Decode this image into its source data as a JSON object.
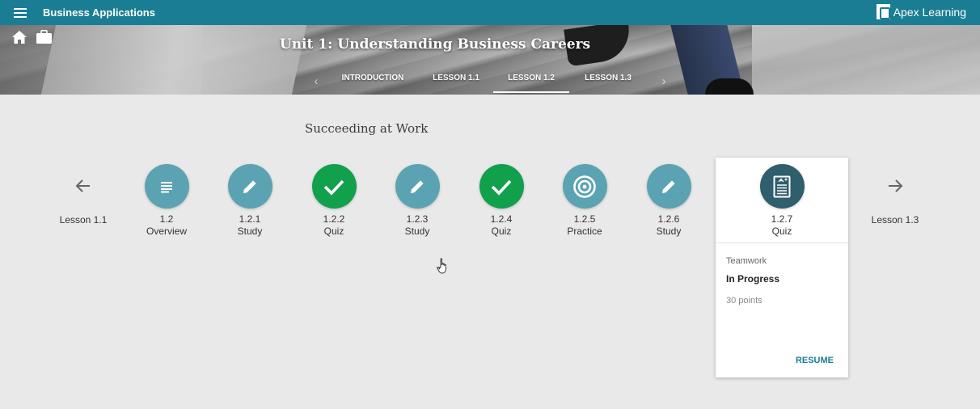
{
  "app": {
    "menu_icon": "hamburger-menu-icon",
    "title": "Business Applications",
    "brand": "Apex Learning"
  },
  "banner": {
    "unit_title": "Unit 1: Understanding Business Careers",
    "tabs": [
      {
        "label": "INTRODUCTION",
        "active": false
      },
      {
        "label": "LESSON 1.1",
        "active": false
      },
      {
        "label": "LESSON 1.2",
        "active": true
      },
      {
        "label": "LESSON 1.3",
        "active": false
      }
    ],
    "prev_icon": "chevron-left-icon",
    "next_icon": "chevron-right-icon",
    "home_icon": "home-icon",
    "briefcase_icon": "briefcase-icon"
  },
  "lesson": {
    "title": "Succeeding at Work",
    "prev_label": "Lesson 1.1",
    "next_label": "Lesson 1.3",
    "steps": [
      {
        "num": "1.2",
        "kind": "Overview",
        "icon": "overview-list-icon",
        "color": "#5ba3b3"
      },
      {
        "num": "1.2.1",
        "kind": "Study",
        "icon": "pencil-icon",
        "color": "#5ba3b3"
      },
      {
        "num": "1.2.2",
        "kind": "Quiz",
        "icon": "checkmark-icon",
        "color": "#11a04c"
      },
      {
        "num": "1.2.3",
        "kind": "Study",
        "icon": "pencil-icon",
        "color": "#5ba3b3"
      },
      {
        "num": "1.2.4",
        "kind": "Quiz",
        "icon": "checkmark-icon",
        "color": "#11a04c"
      },
      {
        "num": "1.2.5",
        "kind": "Practice",
        "icon": "target-icon",
        "color": "#5ba3b3"
      },
      {
        "num": "1.2.6",
        "kind": "Study",
        "icon": "pencil-icon",
        "color": "#5ba3b3"
      }
    ],
    "current": {
      "num": "1.2.7",
      "kind": "Quiz",
      "icon": "quiz-sheet-icon",
      "color": "#2f5e6d",
      "subtitle": "Teamwork",
      "status": "In Progress",
      "points": "30 points",
      "action": "RESUME"
    }
  },
  "colors": {
    "topbar": "#1b7d94",
    "step_blue": "#5ba3b3",
    "step_green": "#11a04c",
    "step_current": "#2f5e6d"
  }
}
